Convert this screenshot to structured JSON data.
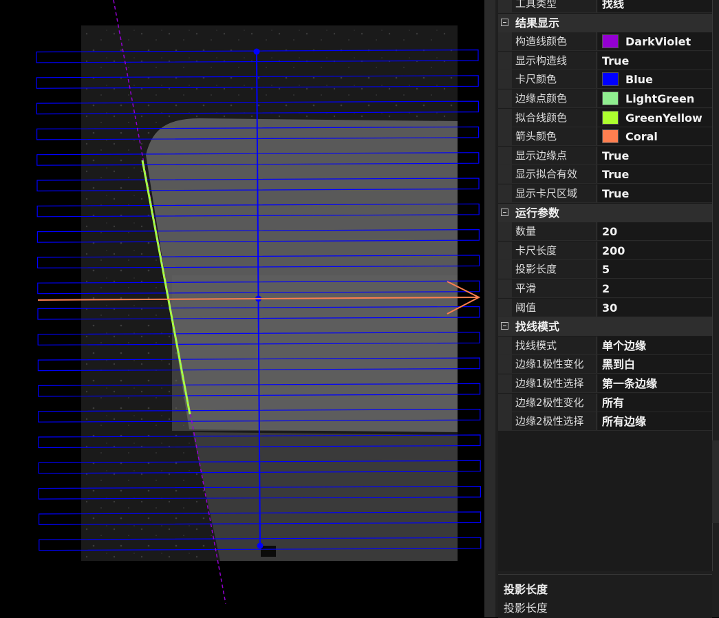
{
  "canvas": {
    "colors": {
      "background": "#000000",
      "construction_line": "#9400D3",
      "caliper": "#0000FF",
      "edge_points": "#90EE90",
      "fit_line": "#ADFF2F",
      "arrow": "#FF7F50"
    }
  },
  "properties": {
    "top_row": {
      "name": "工具类型",
      "value": "找线"
    },
    "categories": [
      {
        "title": "结果显示",
        "rows": [
          {
            "name": "构造线颜色",
            "value": "DarkViolet",
            "swatch": "#9400D3"
          },
          {
            "name": "显示构造线",
            "value": "True"
          },
          {
            "name": "卡尺颜色",
            "value": "Blue",
            "swatch": "#0000FF"
          },
          {
            "name": "边缘点颜色",
            "value": "LightGreen",
            "swatch": "#90EE90"
          },
          {
            "name": "拟合线颜色",
            "value": "GreenYellow",
            "swatch": "#ADFF2F"
          },
          {
            "name": "箭头颜色",
            "value": "Coral",
            "swatch": "#FF7F50"
          },
          {
            "name": "显示边缘点",
            "value": "True"
          },
          {
            "name": "显示拟合有效",
            "value": "True"
          },
          {
            "name": "显示卡尺区域",
            "value": "True"
          }
        ]
      },
      {
        "title": "运行参数",
        "rows": [
          {
            "name": "数量",
            "value": "20"
          },
          {
            "name": "卡尺长度",
            "value": "200"
          },
          {
            "name": "投影长度",
            "value": "5"
          },
          {
            "name": "平滑",
            "value": "2"
          },
          {
            "name": "阈值",
            "value": "30"
          }
        ]
      },
      {
        "title": "找线模式",
        "rows": [
          {
            "name": "找线模式",
            "value": "单个边缘"
          },
          {
            "name": "边缘1极性变化",
            "value": "黑到白"
          },
          {
            "name": "边缘1极性选择",
            "value": "第一条边缘"
          },
          {
            "name": "边缘2极性变化",
            "value": "所有"
          },
          {
            "name": "边缘2极性选择",
            "value": "所有边缘"
          }
        ]
      }
    ]
  },
  "help": {
    "title": "投影长度",
    "description": "投影长度"
  }
}
